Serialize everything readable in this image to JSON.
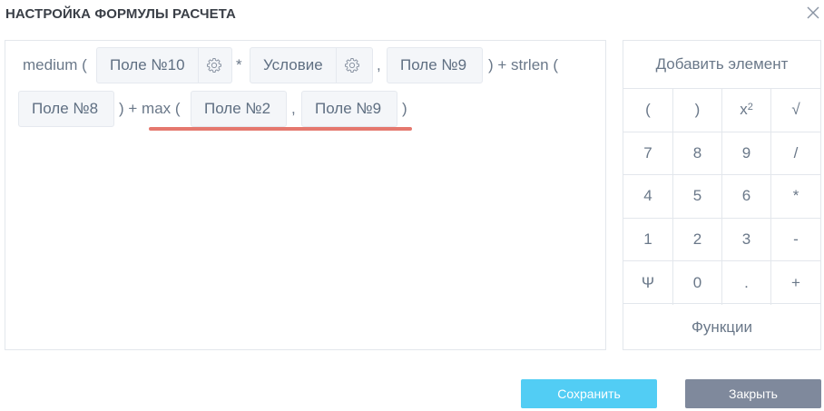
{
  "dialog": {
    "title": "НАСТРОЙКА ФОРМУЛЫ РАСЧЕТА"
  },
  "formula": {
    "t1": "medium (",
    "chip1": "Поле №10",
    "t2": "*",
    "chip2": "Условие",
    "t3": ",",
    "chip3": "Поле №9",
    "t4": ") + strlen (",
    "chip4": "Поле №8",
    "t5": ") + max (",
    "chip5": "Поле №2",
    "t6": ",",
    "chip6": "Поле №9",
    "t7": ")"
  },
  "pad": {
    "header": "Добавить элемент",
    "footer": "Функции",
    "keys": {
      "lparen": "(",
      "rparen": ")",
      "power_base": "x",
      "power_exp": "2",
      "sqrt": "√",
      "k7": "7",
      "k8": "8",
      "k9": "9",
      "div": "/",
      "k4": "4",
      "k5": "5",
      "k6": "6",
      "mul": "*",
      "k1": "1",
      "k2": "2",
      "k3": "3",
      "minus": "-",
      "psi": "Ψ",
      "k0": "0",
      "dot": ".",
      "plus": "+"
    }
  },
  "buttons": {
    "save": "Сохранить",
    "close": "Закрыть"
  },
  "colors": {
    "save_bg": "#52cdf4",
    "close_bg": "#7f899c",
    "underline": "#e5786e"
  }
}
